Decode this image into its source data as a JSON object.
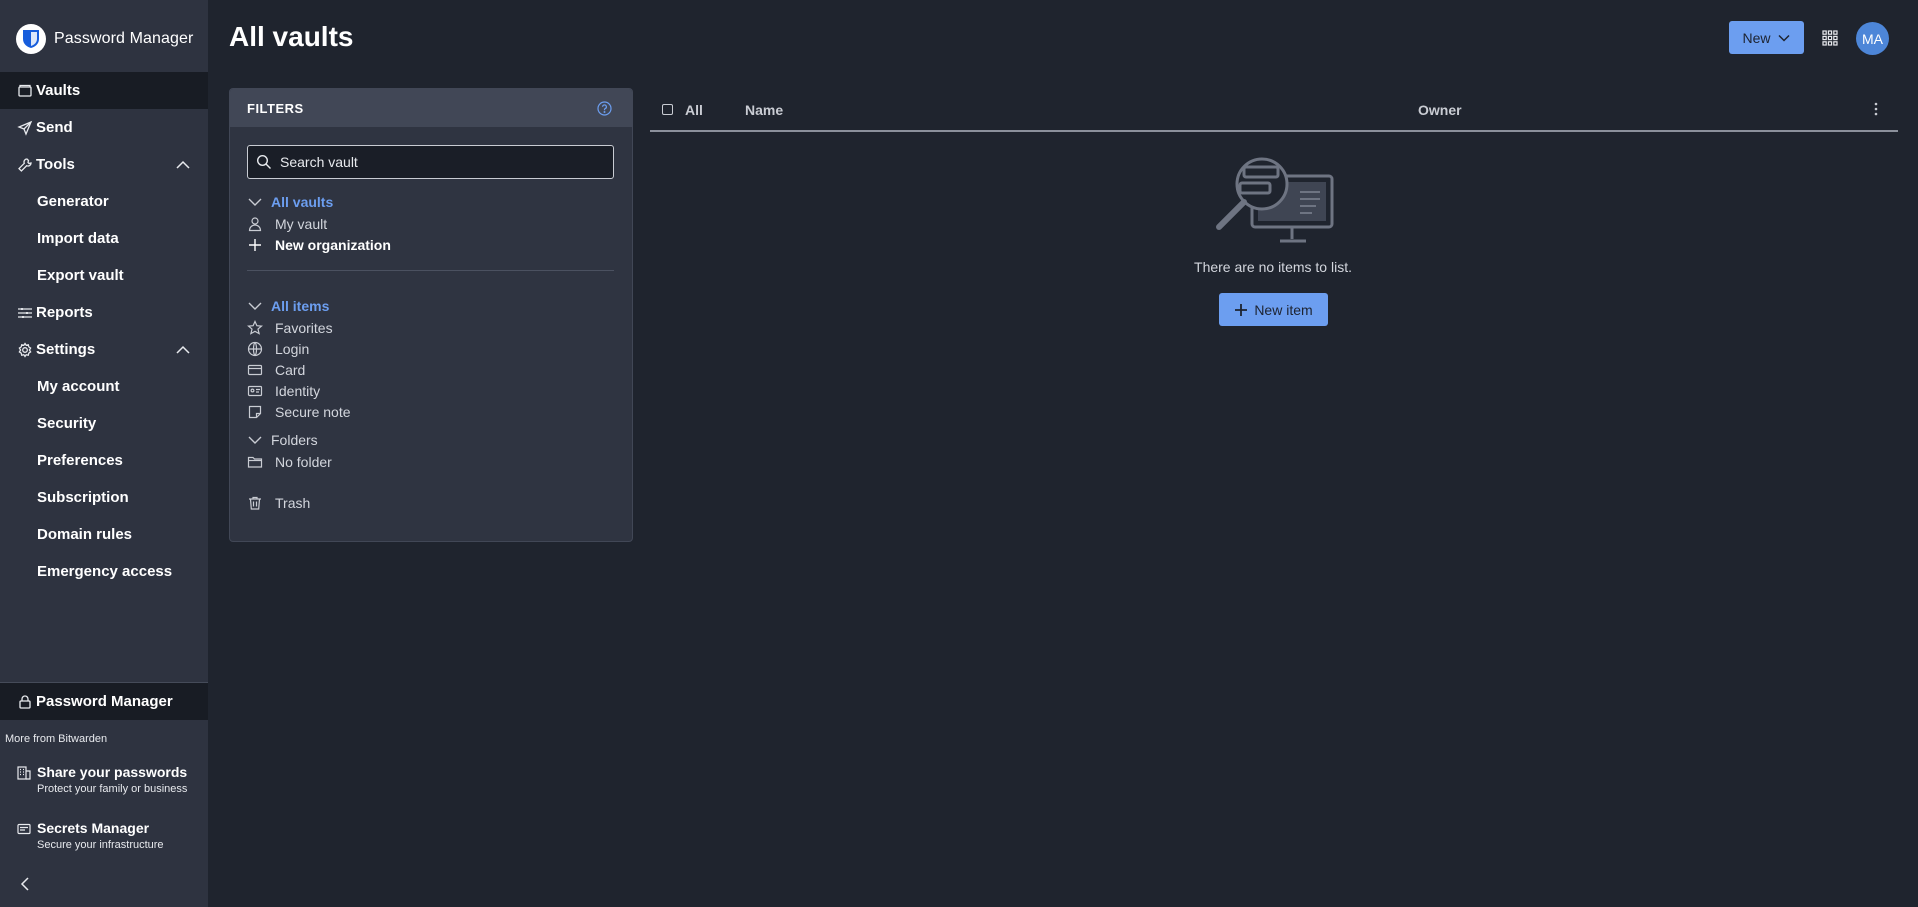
{
  "app": {
    "brand": "Password Manager"
  },
  "sidebar": {
    "vaults": "Vaults",
    "send": "Send",
    "tools": "Tools",
    "generator": "Generator",
    "import_data": "Import data",
    "export_vault": "Export vault",
    "reports": "Reports",
    "settings": "Settings",
    "my_account": "My account",
    "security": "Security",
    "preferences": "Preferences",
    "subscription": "Subscription",
    "domain_rules": "Domain rules",
    "emergency_access": "Emergency access",
    "product_switch": "Password Manager",
    "more_from": "More from Bitwarden",
    "promo_share_title": "Share your passwords",
    "promo_share_sub": "Protect your family or business",
    "promo_secrets_title": "Secrets Manager",
    "promo_secrets_sub": "Secure your infrastructure"
  },
  "header": {
    "title": "All vaults",
    "new_button": "New",
    "avatar_initials": "MA"
  },
  "filters": {
    "title": "FILTERS",
    "search_placeholder": "Search vault",
    "all_vaults": "All vaults",
    "my_vault": "My vault",
    "new_organization": "New organization",
    "all_items": "All items",
    "favorites": "Favorites",
    "login": "Login",
    "card": "Card",
    "identity": "Identity",
    "secure_note": "Secure note",
    "folders": "Folders",
    "no_folder": "No folder",
    "trash": "Trash"
  },
  "table": {
    "all": "All",
    "name": "Name",
    "owner": "Owner",
    "empty_text": "There are no items to list.",
    "new_item_button": "New item"
  },
  "colors": {
    "accent": "#6c9ef0",
    "sidebar_bg": "#2e3340",
    "page_bg": "#1f242e",
    "avatar_bg": "#4d86d8"
  },
  "icons": {
    "vaults": "vault-icon",
    "send": "paper-plane-icon",
    "tools": "wrench-icon",
    "reports": "sliders-icon",
    "settings": "gear-icon",
    "product": "lock-icon",
    "promo_share": "building-icon",
    "promo_secrets": "id-card-icon"
  }
}
